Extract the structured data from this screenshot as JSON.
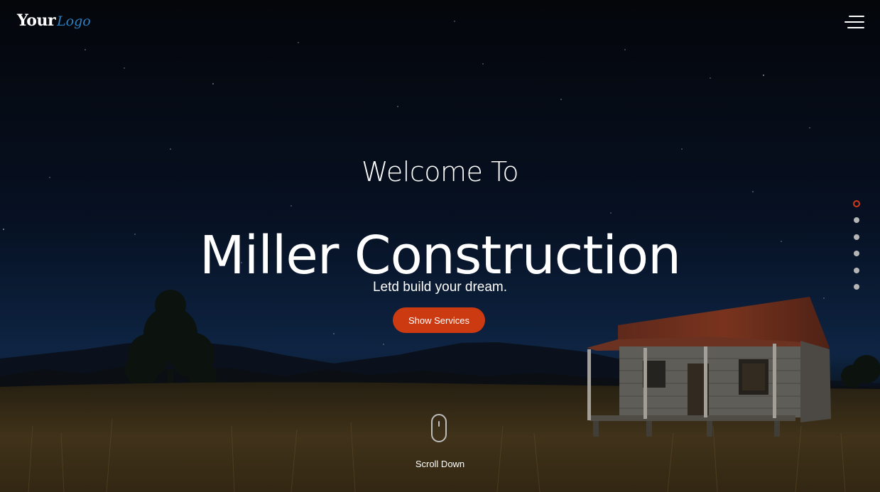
{
  "header": {
    "logo_bold": "Your",
    "logo_script": "Logo",
    "menu_icon": "hamburger-menu-icon"
  },
  "hero": {
    "welcome": "Welcome To",
    "title": "Miller Construction",
    "tagline": "Letd build your dream.",
    "cta_label": "Show Services"
  },
  "pagination": {
    "count": 6,
    "active_index": 0,
    "active_color": "#d23a18",
    "inactive_color": "#b5b5b5"
  },
  "scroll": {
    "icon": "mouse-scroll-icon",
    "label": "Scroll Down"
  },
  "colors": {
    "accent": "#cc3a12",
    "logo_script": "#2e7fc0"
  }
}
